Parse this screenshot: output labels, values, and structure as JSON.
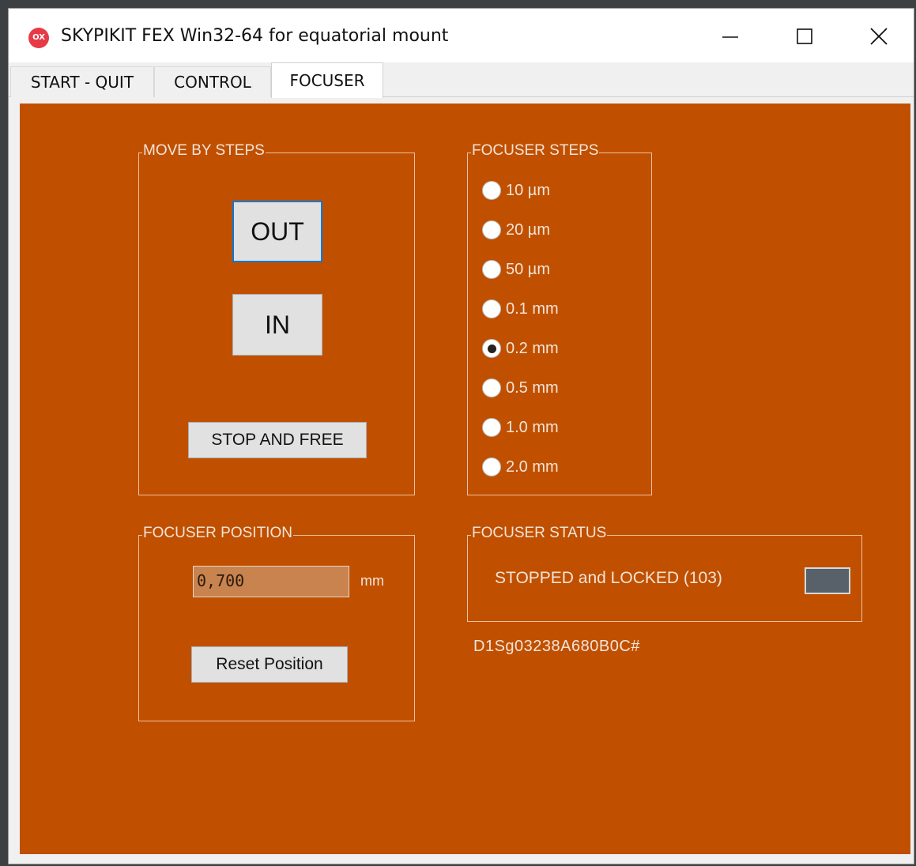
{
  "window": {
    "title": "SKYPIKIT FEX Win32-64  for equatorial mount",
    "icon_label": "OX"
  },
  "tabs": [
    {
      "label": "START - QUIT",
      "active": false
    },
    {
      "label": "CONTROL",
      "active": false
    },
    {
      "label": "FOCUSER",
      "active": true
    }
  ],
  "move_by_steps": {
    "title": "MOVE BY STEPS",
    "out_label": "OUT",
    "in_label": "IN",
    "stop_label": "STOP AND FREE"
  },
  "focuser_steps": {
    "title": "FOCUSER STEPS",
    "options": [
      {
        "label": "10 µm",
        "checked": false
      },
      {
        "label": "20 µm",
        "checked": false
      },
      {
        "label": "50 µm",
        "checked": false
      },
      {
        "label": "0.1 mm",
        "checked": false
      },
      {
        "label": "0.2 mm",
        "checked": true
      },
      {
        "label": "0.5 mm",
        "checked": false
      },
      {
        "label": "1.0 mm",
        "checked": false
      },
      {
        "label": "2.0 mm",
        "checked": false
      }
    ]
  },
  "focuser_position": {
    "title": "FOCUSER POSITION",
    "value": "0,700",
    "unit": "mm",
    "reset_label": "Reset Position"
  },
  "focuser_status": {
    "title": "FOCUSER STATUS",
    "text": "STOPPED and LOCKED (103)",
    "led_color": "#586169"
  },
  "device_id": "D1Sg03238A680B0C#",
  "colors": {
    "panel_bg": "#c05000",
    "accent": "#0a78d7"
  }
}
